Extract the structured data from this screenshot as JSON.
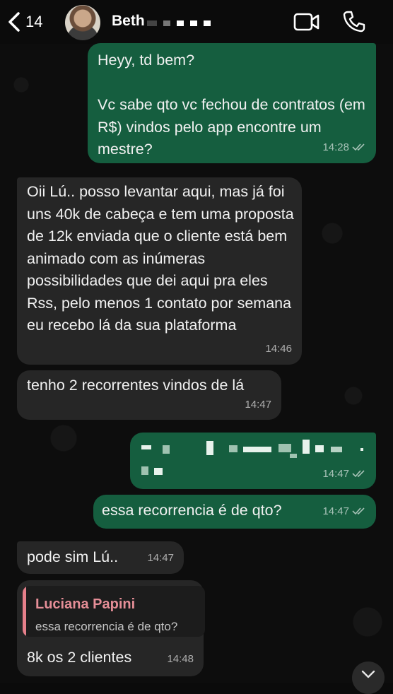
{
  "header": {
    "unread_count": "14",
    "contact_name": "Beth",
    "back_icon": "chevron-left-icon",
    "video_icon": "video-camera-icon",
    "call_icon": "phone-icon"
  },
  "colors": {
    "outgoing_bubble": "#155e3f",
    "incoming_bubble": "#262626",
    "quote_accent": "#e57f8a",
    "background": "#0b0b0b"
  },
  "messages": [
    {
      "direction": "out",
      "text": "Heyy, td bem?\n\nVc sabe qto vc fechou de contratos (em R$) vindos pelo app encontre um mestre?",
      "time": "14:28"
    },
    {
      "direction": "in",
      "text": "Oii Lú.. posso levantar aqui, mas já foi uns 40k de cabeça e tem uma proposta de 12k enviada que o cliente está bem animado com as inúmeras possibilidades que dei aqui pra eles Rss, pelo menos 1 contato por semana eu recebo lá da sua plataforma",
      "time": "14:46"
    },
    {
      "direction": "in",
      "text": "tenho 2 recorrentes vindos de lá",
      "time": "14:47"
    },
    {
      "direction": "out",
      "text": "",
      "time": "14:47"
    },
    {
      "direction": "out",
      "text": "essa recorrencia é de qto?",
      "time": "14:47"
    },
    {
      "direction": "in",
      "text": "pode sim Lú..",
      "time": "14:47"
    },
    {
      "direction": "in",
      "text": "8k os 2 clientes",
      "time": "14:48",
      "reply_to": {
        "author": "Luciana Papini",
        "text": "essa recorrencia é de qto?"
      }
    }
  ]
}
